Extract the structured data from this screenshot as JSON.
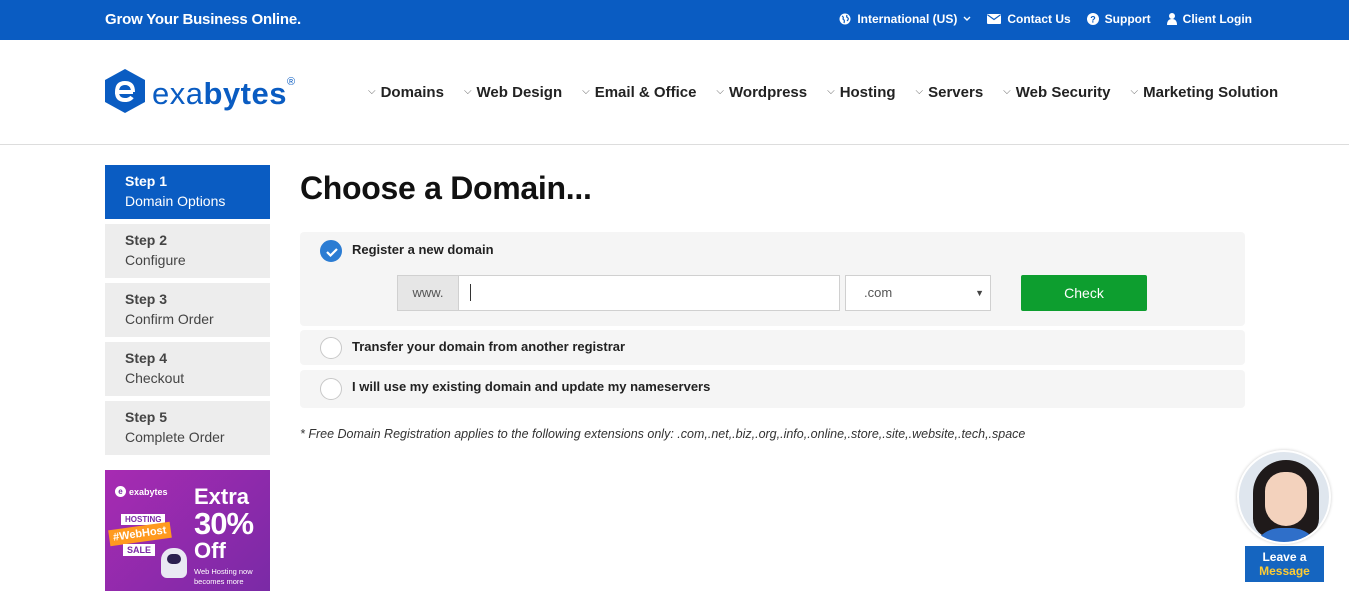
{
  "topbar": {
    "tagline": "Grow Your Business Online.",
    "region": "International (US)",
    "contact": "Contact Us",
    "support": "Support",
    "login": "Client Login"
  },
  "logo": {
    "text_light": "exa",
    "text_bold": "bytes",
    "reg": "®"
  },
  "nav": [
    "Domains",
    "Web Design",
    "Email & Office",
    "Wordpress",
    "Hosting",
    "Servers",
    "Web Security",
    "Marketing Solution"
  ],
  "steps": [
    {
      "num": "Step 1",
      "label": "Domain Options"
    },
    {
      "num": "Step 2",
      "label": "Configure"
    },
    {
      "num": "Step 3",
      "label": "Confirm Order"
    },
    {
      "num": "Step 4",
      "label": "Checkout"
    },
    {
      "num": "Step 5",
      "label": "Complete Order"
    }
  ],
  "promo": {
    "brand": "exabytes",
    "badge_top": "HOSTING",
    "badge_mid": "#WebHost",
    "badge_bottom": "SALE",
    "extra": "Extra",
    "percent": "30%",
    "off": "Off",
    "small": "Web Hosting now becomes more"
  },
  "main": {
    "title": "Choose a Domain...",
    "option_register": "Register a new domain",
    "www_prefix": "www.",
    "domain_value": "",
    "tld_selected": ".com",
    "check_label": "Check",
    "option_transfer": "Transfer your domain from another registrar",
    "option_existing": "I will use my existing domain and update my nameservers",
    "note": "* Free Domain Registration applies to the following extensions only: .com,.net,.biz,.org,.info,.online,.store,.site,.website,.tech,.space"
  },
  "chat": {
    "line1": "Leave a",
    "line2": "Message"
  },
  "colors": {
    "brand_blue": "#0a5cc2",
    "check_green": "#0d9e2f"
  }
}
